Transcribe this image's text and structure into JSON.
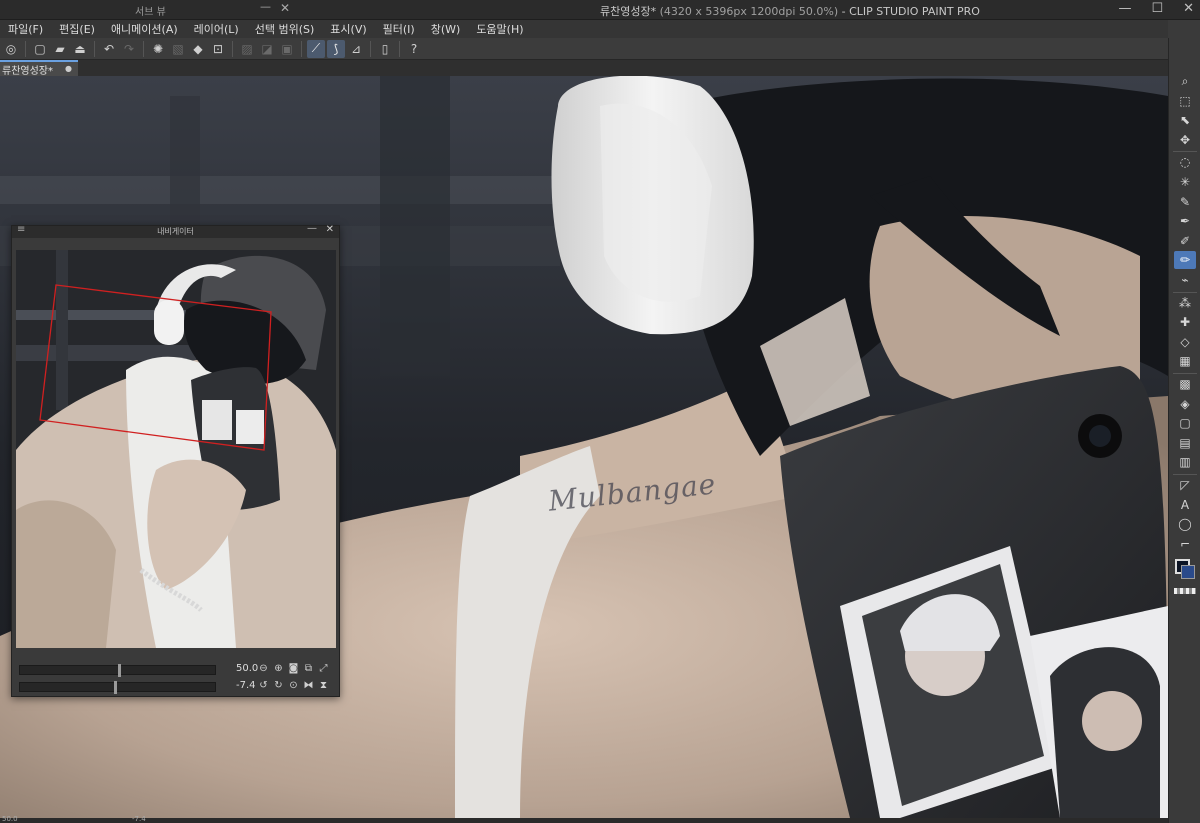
{
  "titlebar": {
    "subview_title": "서브 뷰",
    "doc_name": "류찬영성장*",
    "doc_info": " (4320 x 5396px 1200dpi 50.0%)",
    "app_name": " - CLIP STUDIO PAINT PRO",
    "minimize_glyph": "—",
    "maximize_glyph": "☐",
    "close_glyph": "✕"
  },
  "menu": [
    "파일(F)",
    "편집(E)",
    "애니메이션(A)",
    "레이어(L)",
    "선택 범위(S)",
    "표시(V)",
    "필터(I)",
    "창(W)",
    "도움말(H)"
  ],
  "toolbar_icons": [
    {
      "name": "clip-studio-icon",
      "glyph": "◎"
    },
    {
      "name": "new-file-icon",
      "glyph": "▢"
    },
    {
      "name": "open-folder-icon",
      "glyph": "▰"
    },
    {
      "name": "save-icon",
      "glyph": "⏏"
    },
    {
      "name": "undo-icon",
      "glyph": "↶"
    },
    {
      "name": "redo-icon",
      "glyph": "↷"
    },
    {
      "name": "loading-icon",
      "glyph": "✺"
    },
    {
      "name": "clear-icon",
      "glyph": "▧"
    },
    {
      "name": "fill-icon",
      "glyph": "◆"
    },
    {
      "name": "transform-icon",
      "glyph": "⊡"
    },
    {
      "name": "deselect-icon",
      "glyph": "▨"
    },
    {
      "name": "invert-selection-icon",
      "glyph": "◪"
    },
    {
      "name": "selection-fill-icon",
      "glyph": "▣"
    },
    {
      "name": "snap-ruler-icon",
      "glyph": "⟋"
    },
    {
      "name": "snap-curve-icon",
      "glyph": "⟆"
    },
    {
      "name": "snap-special-icon",
      "glyph": "⊿"
    },
    {
      "name": "device-icon",
      "glyph": "▯"
    },
    {
      "name": "help-icon",
      "glyph": "?"
    }
  ],
  "doc_tab": {
    "label": "류찬영성장*",
    "dirty_mark": "●"
  },
  "watermark": "Mulbangae",
  "navigator": {
    "title": "내비게이터",
    "menu_glyph": "≡",
    "min_glyph": "—",
    "close_glyph": "✕",
    "zoom_value": "50.0",
    "zoom_level": 0.5,
    "rotation_value": "-7.4",
    "rotation_level": 0.48,
    "icons_row1": [
      {
        "name": "zoom-out-icon",
        "glyph": "⊖"
      },
      {
        "name": "zoom-in-icon",
        "glyph": "⊕"
      },
      {
        "name": "actual-size-icon",
        "glyph": "◙"
      },
      {
        "name": "fit-navigator-icon",
        "glyph": "⧉"
      },
      {
        "name": "fit-window-icon",
        "glyph": "⤢"
      }
    ],
    "icons_row2": [
      {
        "name": "rotate-left-icon",
        "glyph": "↺"
      },
      {
        "name": "rotate-right-icon",
        "glyph": "↻"
      },
      {
        "name": "reset-rotation-icon",
        "glyph": "⊙"
      },
      {
        "name": "flip-horizontal-icon",
        "glyph": "⧓"
      },
      {
        "name": "flip-vertical-icon",
        "glyph": "⧗"
      }
    ]
  },
  "tools": [
    {
      "name": "zoom-tool-icon",
      "glyph": "⌕"
    },
    {
      "name": "operation-tool-icon",
      "glyph": "⬚"
    },
    {
      "name": "object-tool-icon",
      "glyph": "⬉"
    },
    {
      "name": "move-tool-icon",
      "glyph": "✥"
    },
    {
      "name": "lasso-tool-icon",
      "glyph": "◌"
    },
    {
      "name": "auto-select-tool-icon",
      "glyph": "✳"
    },
    {
      "name": "eyedropper-tool-icon",
      "glyph": "✎"
    },
    {
      "name": "pen-tool-icon",
      "glyph": "✒"
    },
    {
      "name": "pencil-tool-icon",
      "glyph": "✐"
    },
    {
      "name": "brush-tool-icon",
      "glyph": "✏",
      "active": true
    },
    {
      "name": "airbrush-tool-icon",
      "glyph": "⌁"
    },
    {
      "name": "decoration-tool-icon",
      "glyph": "⁂"
    },
    {
      "name": "sparkle-tool-icon",
      "glyph": "✚"
    },
    {
      "name": "eraser-tool-icon",
      "glyph": "◇"
    },
    {
      "name": "blend-tool-icon",
      "glyph": "▦"
    },
    {
      "name": "figure-tool-icon",
      "glyph": "▩"
    },
    {
      "name": "fill-tool-icon",
      "glyph": "◈"
    },
    {
      "name": "gradient-tool-icon",
      "glyph": "▢"
    },
    {
      "name": "frame-tool-icon",
      "glyph": "▤"
    },
    {
      "name": "ruler-tool-icon",
      "glyph": "▥"
    },
    {
      "name": "figure-ruler-tool-icon",
      "glyph": "◸"
    },
    {
      "name": "text-tool-icon",
      "glyph": "A"
    },
    {
      "name": "balloon-tool-icon",
      "glyph": "◯"
    },
    {
      "name": "correct-line-tool-icon",
      "glyph": "⌐"
    }
  ],
  "colors": {
    "main": "#0c1424",
    "sub": "#2a4a8a",
    "active_tool": "#4d79b8",
    "nav_frame": "#d02020"
  },
  "status": {
    "zoom": "50.0",
    "rotation": "-7.4"
  }
}
